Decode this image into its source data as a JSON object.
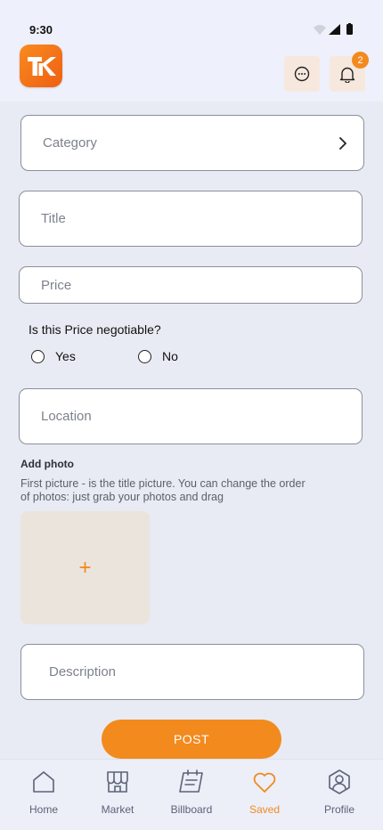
{
  "status_bar": {
    "time": "9:30"
  },
  "header": {
    "logo_text": "TK",
    "notification_count": "2"
  },
  "form": {
    "category_placeholder": "Category",
    "title_placeholder": "Title",
    "price_placeholder": "Price",
    "negotiable_question": "Is this Price negotiable?",
    "options": [
      "Yes",
      "No"
    ],
    "location_placeholder": "Location",
    "add_photo_label": "Add photo",
    "add_photo_hint": "First picture - is the title picture. You can change the order of photos: just grab your photos and drag",
    "add_photo_plus": "+",
    "description_placeholder": "Description",
    "post_label": "POST"
  },
  "bottom_nav": {
    "items": [
      {
        "label": "Home",
        "icon": "home-icon"
      },
      {
        "label": "Market",
        "icon": "market-icon"
      },
      {
        "label": "Billboard",
        "icon": "billboard-icon"
      },
      {
        "label": "Saved",
        "icon": "heart-icon",
        "active": true
      },
      {
        "label": "Profile",
        "icon": "profile-icon"
      }
    ]
  },
  "colors": {
    "accent": "#f28a1e",
    "background": "#e8ebf3",
    "header_bg": "#eef0fb"
  }
}
